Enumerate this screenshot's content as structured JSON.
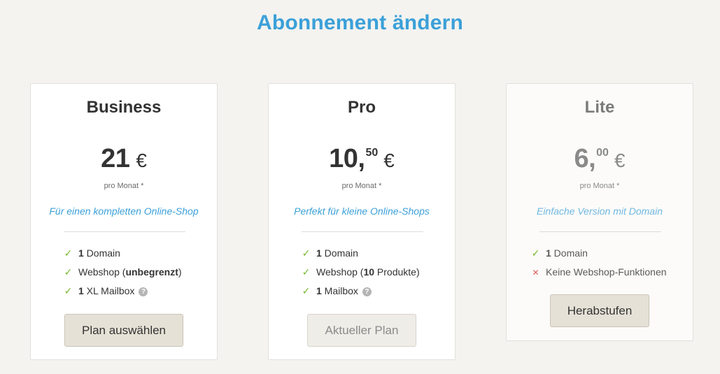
{
  "header": {
    "title": "Abonnement ändern"
  },
  "plans": [
    {
      "name": "Business",
      "price": {
        "main": "21",
        "cents": "",
        "currency": "€"
      },
      "period": "pro Monat *",
      "tagline": "Für einen kompletten Online-Shop",
      "features": [
        {
          "icon": "check-icon",
          "bold": "1",
          "text": " Domain"
        },
        {
          "icon": "check-icon",
          "prefix": "Webshop (",
          "bold": "unbegrenzt",
          "suffix": ")"
        },
        {
          "icon": "check-icon",
          "bold": "1",
          "text": " XL Mailbox",
          "help": "?"
        }
      ],
      "button": {
        "label": "Plan auswählen",
        "state": "enabled"
      }
    },
    {
      "name": "Pro",
      "price": {
        "main": "10,",
        "cents": "50",
        "currency": "€"
      },
      "period": "pro Monat *",
      "tagline": "Perfekt für kleine Online-Shops",
      "features": [
        {
          "icon": "check-icon",
          "bold": "1",
          "text": " Domain"
        },
        {
          "icon": "check-icon",
          "prefix": "Webshop (",
          "bold": "10",
          "suffix": " Produkte)"
        },
        {
          "icon": "check-icon",
          "bold": "1",
          "text": " Mailbox",
          "help": "?"
        }
      ],
      "button": {
        "label": "Aktueller Plan",
        "state": "disabled"
      }
    },
    {
      "name": "Lite",
      "price": {
        "main": "6,",
        "cents": "00",
        "currency": "€"
      },
      "period": "pro Monat *",
      "tagline": "Einfache Version mit Domain",
      "features": [
        {
          "icon": "check-icon",
          "bold": "1",
          "text": " Domain"
        },
        {
          "icon": "cross-icon",
          "text": "Keine Webshop-Funktionen"
        }
      ],
      "button": {
        "label": "Herabstufen",
        "state": "enabled"
      }
    }
  ],
  "icons": {
    "check": "✓",
    "cross": "✕"
  },
  "colors": {
    "accent": "#3ba0d8",
    "check": "#76b82a",
    "cross": "#e06060",
    "background": "#f4f3f0"
  }
}
